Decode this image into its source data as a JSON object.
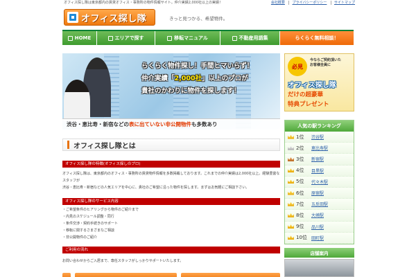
{
  "top": {
    "tagline": "オフィス探し隊は東京都内の賃貸オフィス・事務所の物件情報サイト。仲介実績2,000社以上の実績！",
    "links": [
      "会社概要",
      "プライバシーポリシー",
      "サイトマップ"
    ]
  },
  "header": {
    "logo_text": "オフィス探し隊",
    "tagline": "きっと見つかる、希望物件。"
  },
  "nav": {
    "items": [
      {
        "label": "HOME"
      },
      {
        "label": "エリアで探す"
      },
      {
        "label": "移転マニュアル"
      },
      {
        "label": "不動産用語集"
      },
      {
        "label": "らくらく無料相談！"
      }
    ]
  },
  "hero": {
    "line1": "らくらく物件探し！手間ヒマいらず！",
    "line2a": "仲介実績「",
    "line2b": "2,000社",
    "line2c": "」以上のプロが",
    "line3": "貴社のかわりに物件を探します！",
    "bar_a": "渋谷・恵比寿・新宿などの",
    "bar_b": "表に出ていない非公開物件",
    "bar_c": "も多数あり"
  },
  "main": {
    "section_title": "オフィス探し隊とは",
    "bar1": "オフィス探し隊の特徴(オフィス探しのプロ)",
    "para1a": "オフィス探し隊は、東京都内のオフィス・事務所の賃貸物件情報を多数掲載しております。これまでの仲介実績は2,000社以上。経験豊富なスタッフが",
    "para1b": "渋谷・恵比寿・新宿などの人気エリアを中心に、貴社のご希望に沿った物件を探します。まずはお気軽にご相談下さい。",
    "bar2": "オフィス探し隊のサービス内容",
    "list": [
      "・ご希望条件のヒアリングから物件のご紹介まで",
      "・内見のスケジュール調整・同行",
      "・条件交渉・契約手続きのサポート",
      "・移転に関するさまざまなご相談",
      "・非公開物件のご紹介"
    ],
    "bar3": "ご利用の流れ",
    "para3": "お問い合わせからご入居まで、専任スタッフがしっかりサポートいたします。"
  },
  "promo": {
    "badge": "必見",
    "small1": "今ならご契約頂いた",
    "small2": "お客様全員に",
    "line1": "オフィス探し隊",
    "line2": "だけの超豪華",
    "line3": "特典プレゼント"
  },
  "ranking": {
    "title": "人気の駅ランキング",
    "rows": [
      {
        "pos": "1位",
        "station": "渋谷駅",
        "crown": "gold"
      },
      {
        "pos": "2位",
        "station": "恵比寿駅",
        "crown": "silver"
      },
      {
        "pos": "3位",
        "station": "新宿駅",
        "crown": "bronze"
      },
      {
        "pos": "4位",
        "station": "目黒駅",
        "crown": "gold"
      },
      {
        "pos": "5位",
        "station": "代々木駅",
        "crown": "gold"
      },
      {
        "pos": "6位",
        "station": "原宿駅",
        "crown": "gold"
      },
      {
        "pos": "7位",
        "station": "五反田駅",
        "crown": "gold"
      },
      {
        "pos": "8位",
        "station": "大崎駅",
        "crown": "gold"
      },
      {
        "pos": "9位",
        "station": "品川駅",
        "crown": "gold"
      },
      {
        "pos": "10位",
        "station": "田町駅",
        "crown": "gold"
      }
    ]
  },
  "store": {
    "title": "店舗案内"
  }
}
